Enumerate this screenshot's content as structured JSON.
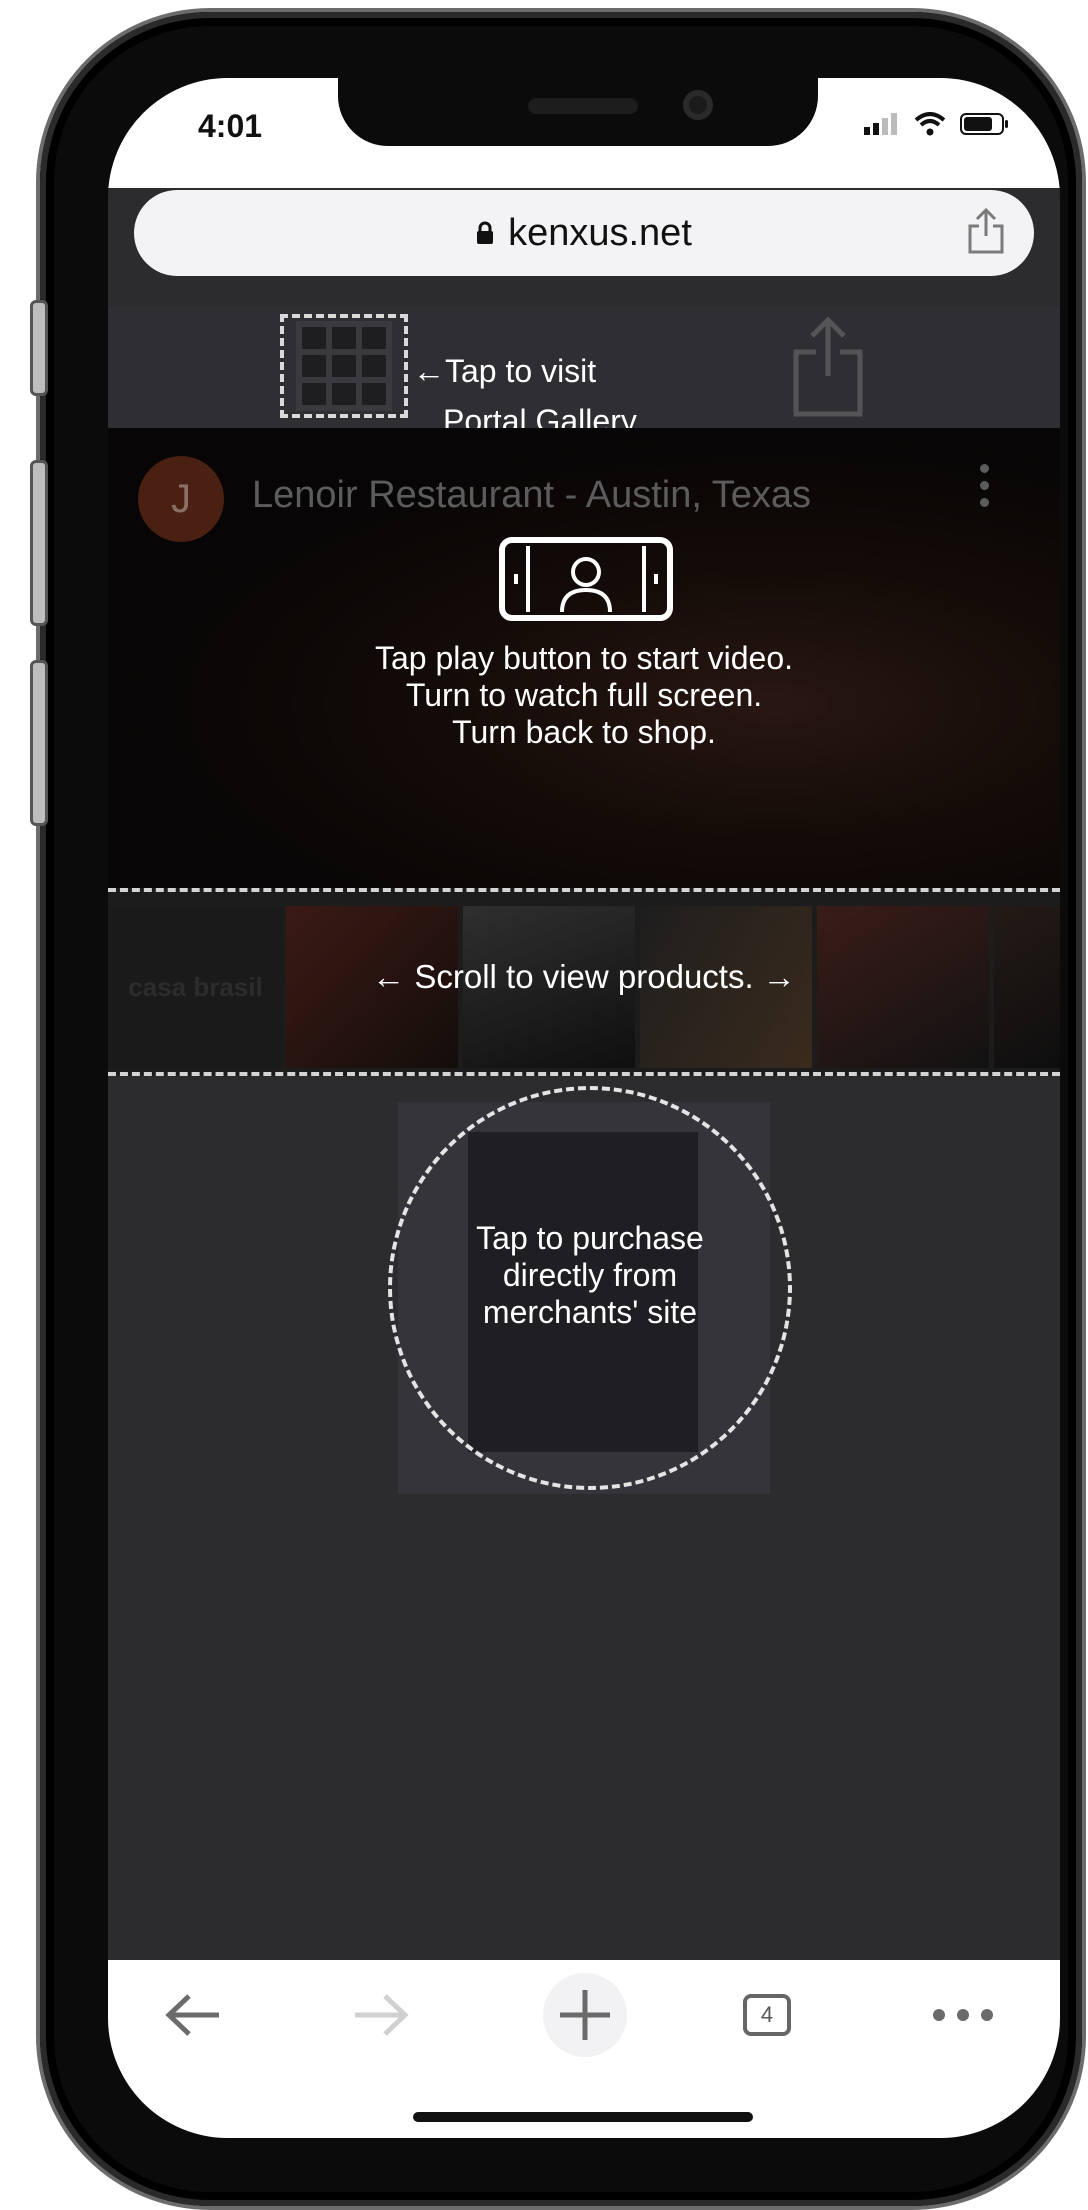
{
  "status_bar": {
    "time": "4:01",
    "icons": [
      "signal-icon",
      "wifi-icon",
      "battery-icon"
    ]
  },
  "browser": {
    "address": "kenxus.net",
    "icons": [
      "lock-icon",
      "share-icon"
    ]
  },
  "portal": {
    "hint_line1": "←Tap to visit",
    "hint_line2": "Portal Gallery",
    "icons": [
      "grid-icon",
      "share-icon"
    ]
  },
  "video": {
    "channel_initial": "J",
    "title": "Lenoir Restaurant - Austin, Texas",
    "instruction_line1": "Tap play button to start video.",
    "instruction_line2": "Turn to watch full screen.",
    "instruction_line3": "Turn back to shop.",
    "icons": [
      "rotate-phone-icon",
      "more-vertical-icon"
    ]
  },
  "products": {
    "brand": "casa brasil",
    "scroll_hint": "← Scroll to view products. →"
  },
  "purchase": {
    "line1": "Tap to purchase",
    "line2": "directly from",
    "line3": "merchants' site"
  },
  "toolbar": {
    "tab_count": "4",
    "icons": [
      "back-arrow-icon",
      "forward-arrow-icon",
      "new-tab-icon",
      "tabs-icon",
      "more-icon"
    ]
  },
  "colors": {
    "page_dark": "#2c2c2e",
    "overlay_text": "#ffffff",
    "dash": "#d4d4d4"
  }
}
